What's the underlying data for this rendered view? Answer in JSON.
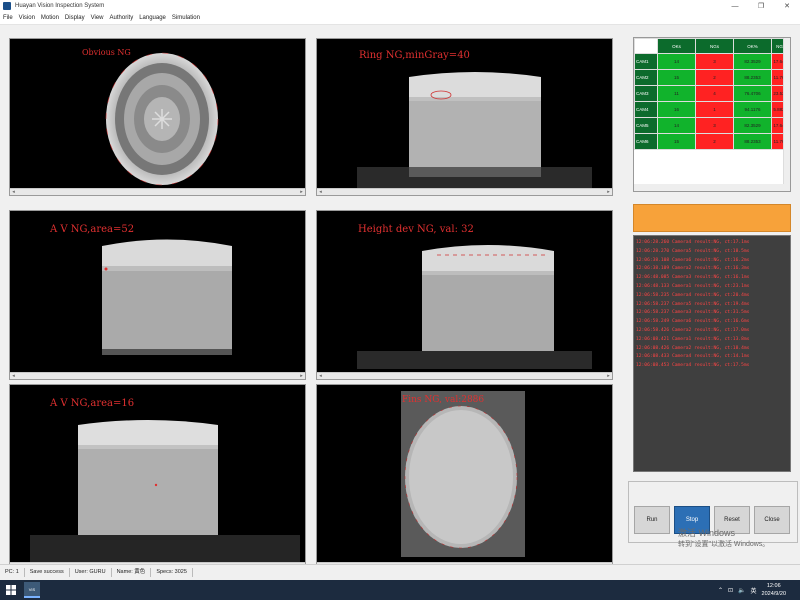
{
  "window": {
    "title": "Huayan Vision Inspection System",
    "min": "—",
    "max": "❐",
    "close": "✕"
  },
  "menu": [
    "File",
    "Vision",
    "Motion",
    "Display",
    "View",
    "Authority",
    "Language",
    "Simulation"
  ],
  "cameras": [
    {
      "label": "Obvious NG"
    },
    {
      "label": "Ring NG,minGray=40"
    },
    {
      "label": "A V NG,area=52"
    },
    {
      "label": "Height dev NG, val: 32"
    },
    {
      "label": "A V NG,area=16"
    },
    {
      "label": "Fins NG, val:2886"
    }
  ],
  "stats": {
    "headers": [
      "OKs",
      "NGs",
      "OK%",
      "NG%"
    ],
    "rows": [
      {
        "name": "CAM1",
        "oks": "14",
        "ngs": "3",
        "okp": "82.3529",
        "ngp": "17.6471"
      },
      {
        "name": "CAM2",
        "oks": "15",
        "ngs": "2",
        "okp": "88.2353",
        "ngp": "11.7647"
      },
      {
        "name": "CAM3",
        "oks": "11",
        "ngs": "4",
        "okp": "76.4706",
        "ngp": "23.5294"
      },
      {
        "name": "CAM4",
        "oks": "16",
        "ngs": "1",
        "okp": "94.1176",
        "ngp": "5.88235"
      },
      {
        "name": "CAM5",
        "oks": "14",
        "ngs": "3",
        "okp": "82.3529",
        "ngp": "17.6471"
      },
      {
        "name": "CAM6",
        "oks": "15",
        "ngs": "2",
        "okp": "88.2353",
        "ngp": "11.7647"
      }
    ]
  },
  "log": [
    "12:06:28.260  Camera4 result:NG, ct:17.1ms",
    "12:06:28.270  Camera5 result:NG, ct:18.5ms",
    "12:06:38.108  Camera6 result:NG, ct:16.2ms",
    "12:06:38.109  Camera2 result:NG, ct:16.3ms",
    "12:06:48.085  Camera3 result:NG, ct:16.1ms",
    "12:06:48.133  Camera1 result:NG, ct:23.1ms",
    "12:06:58.235  Camera4 result:NG, ct:20.4ms",
    "12:06:58.237  Camera5 result:NG, ct:19.4ms",
    "12:06:58.237  Camera3 result:NG, ct:31.5ms",
    "12:06:58.249  Camera6 result:NG, ct:16.6ms",
    "12:06:58.426  Camera2 result:NG, ct:17.0ms",
    "12:06:08.421  Camera1 result:NG, ct:13.8ms",
    "12:06:08.426  Camera2 result:NG, ct:18.4ms",
    "12:06:08.433  Camera4 result:NG, ct:14.1ms",
    "12:06:08.453  Camera4 result:NG, ct:17.5ms"
  ],
  "controls": {
    "run": "Run",
    "stop": "Stop",
    "reset": "Reset",
    "close": "Close"
  },
  "watermark": {
    "line1": "激活 Windows",
    "line2": "转到\"设置\"以激活 Windows。"
  },
  "status": {
    "pc": "PC: 1",
    "save": "Save success",
    "user": "User: GURU",
    "name": "Name: 黄色",
    "specs": "Specs: 3025"
  },
  "taskbar": {
    "app_label": "VIS",
    "lang": "英",
    "time": "12:06",
    "date": "2024/9/20"
  },
  "colors": {
    "ok_green": "#11b32c",
    "ng_red": "#ff2222",
    "header_green": "#0c6b2c",
    "orange": "#f7a23a",
    "stop_blue": "#2c6fb5",
    "label_red": "#e03030"
  }
}
